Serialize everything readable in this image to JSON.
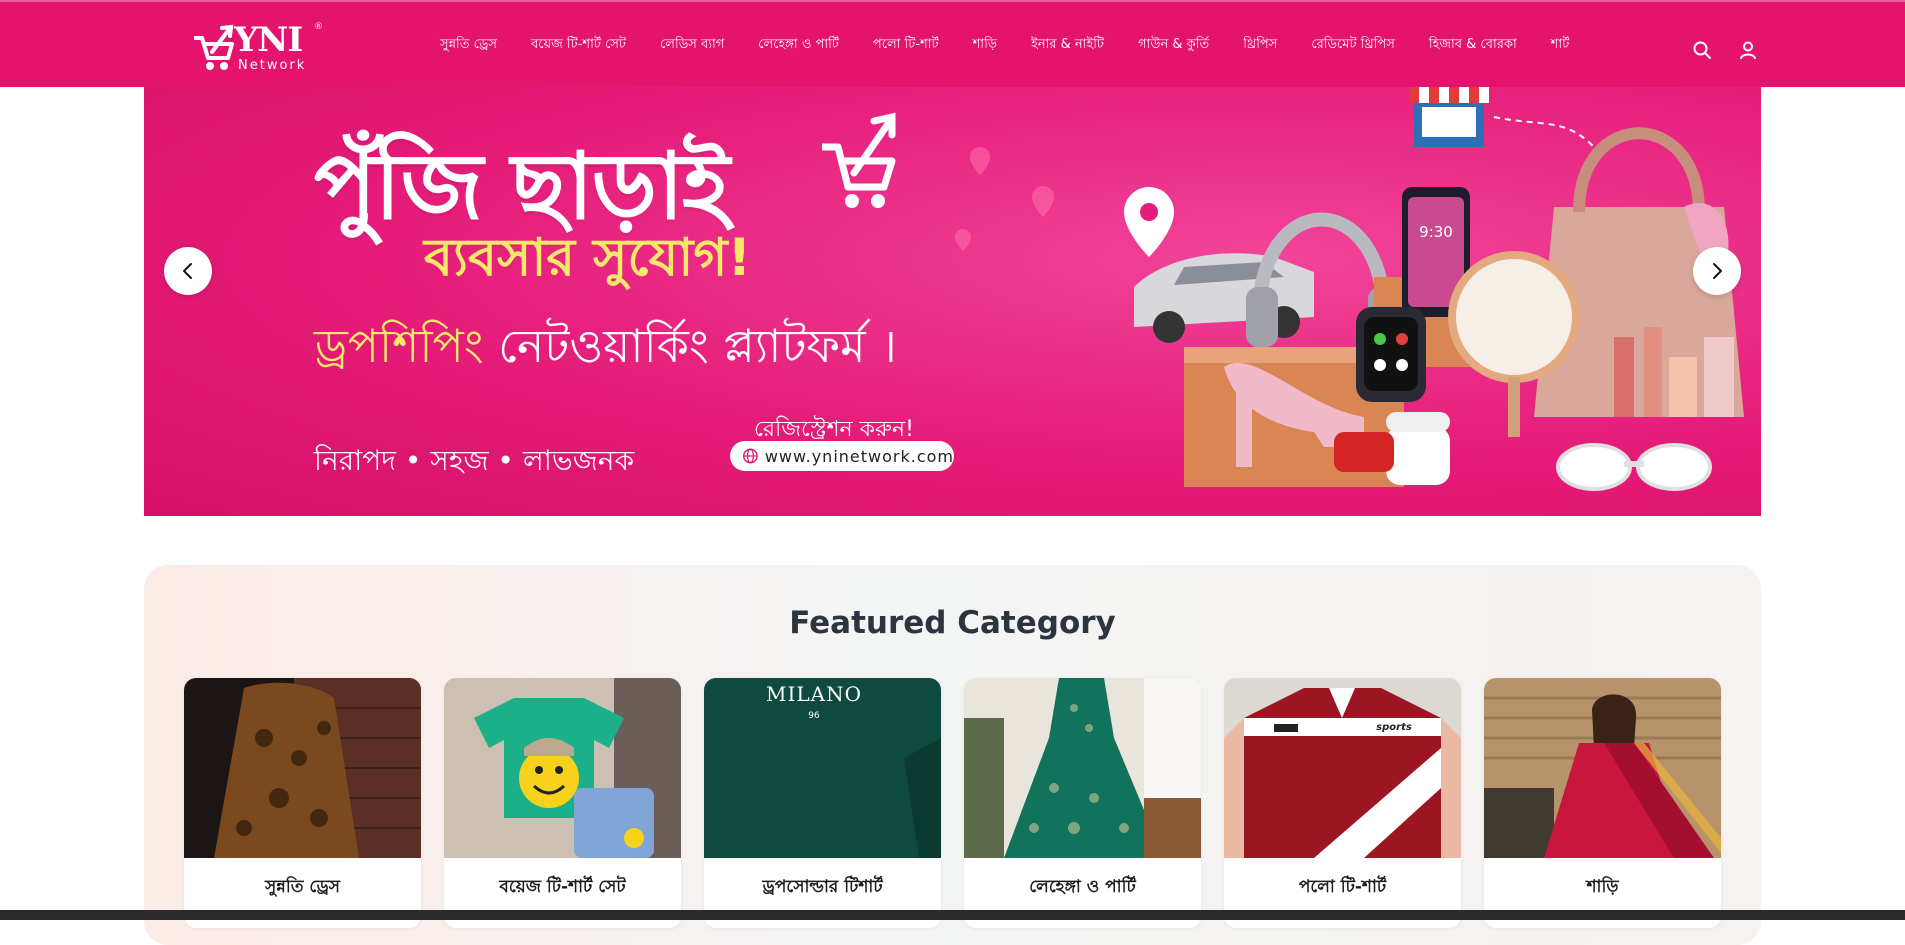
{
  "header": {
    "logo": {
      "brand": "YNI",
      "sub": "Network",
      "reg": "®",
      "icon": "cart-arrow-icon"
    },
    "nav": [
      "সুন্নতি ড্রেস",
      "বয়েজ টি-শার্ট সেট",
      "লেডিস ব্যাগ",
      "লেহেঙ্গা ও পার্টি",
      "পলো টি-শার্ট",
      "শাড়ি",
      "ইনার & নাইটি",
      "গাউন & কুর্তি",
      "থ্রিপিস",
      "রেডিমেট থ্রিপিস",
      "হিজাব & বোরকা",
      "শার্ট"
    ],
    "icons": [
      "search-icon",
      "user-icon"
    ]
  },
  "banner": {
    "title": "পুঁজি ছাড়াই",
    "subtitle": "ব্যবসার সুযোগ!",
    "line3_highlight": "ড্রপশিপিং",
    "line3_rest": " নেটওয়ার্কিং প্ল্যাটফর্ম ।",
    "tagline": "নিরাপদ • সহজ • লাভজনক",
    "register": "রেজিস্ট্রেশন করুন!",
    "url": "www.yninetwork.com",
    "prev_icon": "chevron-left-icon",
    "next_icon": "chevron-right-icon"
  },
  "featured": {
    "title": "Featured Category",
    "categories": [
      {
        "label": "সুন্নতি ড্রেস"
      },
      {
        "label": "বয়েজ টি-শার্ট সেট"
      },
      {
        "label": "ড্রপসোল্ডার টিশার্ট",
        "image_text": "MILANO",
        "image_num": "96"
      },
      {
        "label": "লেহেঙ্গা ও পার্টি"
      },
      {
        "label": "পলো টি-শার্ট",
        "image_text": "sports"
      },
      {
        "label": "শাড়ি"
      }
    ]
  },
  "colors": {
    "brand": "#e3136e",
    "banner": "#e51c79",
    "highlight": "#f6e96a"
  }
}
